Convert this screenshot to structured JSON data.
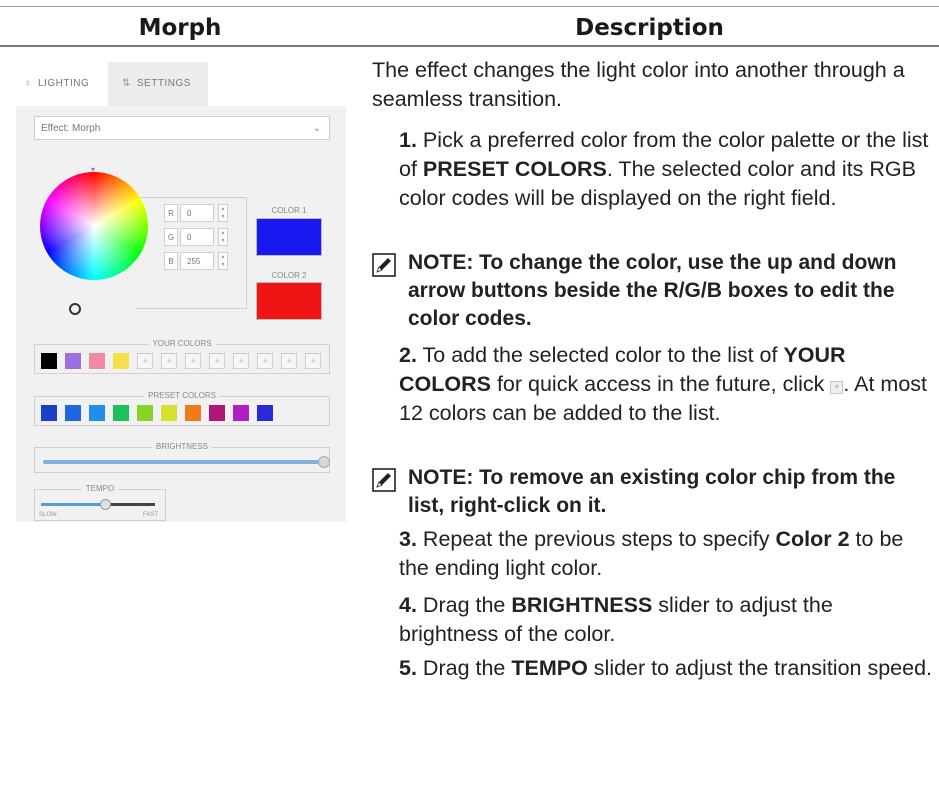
{
  "table": {
    "col_left_header": "Morph",
    "col_right_header": "Description"
  },
  "app": {
    "tabs": [
      {
        "label": "LIGHTING",
        "icon": "bulb-icon"
      },
      {
        "label": "SETTINGS",
        "icon": "sliders-icon"
      }
    ],
    "effect_label": "Effect: Morph",
    "rgb": [
      {
        "channel": "R",
        "value": "0"
      },
      {
        "channel": "G",
        "value": "0"
      },
      {
        "channel": "B",
        "value": "255"
      }
    ],
    "color1_label": "COLOR 1",
    "color1_hex": "#1a18f0",
    "color2_label": "COLOR 2",
    "color2_hex": "#f01414",
    "your_colors_label": "YOUR COLORS",
    "your_colors": [
      "#000000",
      "#9d6fe0",
      "#f08aa0",
      "#f5e04a"
    ],
    "your_colors_empty_slots": 8,
    "preset_colors_label": "PRESET COLORS",
    "preset_colors": [
      "#1b3fc9",
      "#1f66e0",
      "#1f8fe8",
      "#1fc05a",
      "#86d42a",
      "#d8e030",
      "#f07a1a",
      "#b0157a",
      "#b020c0",
      "#2a2ad8"
    ],
    "brightness_label": "BRIGHTNESS",
    "brightness_level": 1.0,
    "tempo_label": "TEMPO",
    "tempo_min_label": "SLOW",
    "tempo_max_label": "FAST",
    "tempo_level": 0.55
  },
  "description": {
    "intro": "The effect changes the light color into another through a seamless transition.",
    "step1_num": "1.",
    "step1_a": "Pick a preferred color from the color palette or the list of ",
    "step1_b": "PRESET COLORS",
    "step1_c": ". The selected color and its RGB color codes will be displayed on the right field.",
    "note1": "NOTE: To change the color, use the up and down arrow buttons beside the R/G/B boxes to edit the color codes.",
    "step2_num": "2.",
    "step2_a": "To add the selected color to the list of ",
    "step2_b": "YOUR COLORS",
    "step2_c": " for quick access in the future, click ",
    "step2_d": ". At most 12 colors can be added to the list.",
    "note2": "NOTE: To remove an existing color chip from the list, right-click on it.",
    "step3_num": "3.",
    "step3_a": "Repeat the previous steps to specify ",
    "step3_b": "Color 2",
    "step3_c": " to be the ending light color.",
    "step4_num": "4.",
    "step4_a": "Drag the ",
    "step4_b": "BRIGHTNESS",
    "step4_c": " slider to adjust the brightness of the color.",
    "step5_num": "5.",
    "step5_a": "Drag the ",
    "step5_b": "TEMPO",
    "step5_c": " slider to adjust the transition speed."
  }
}
